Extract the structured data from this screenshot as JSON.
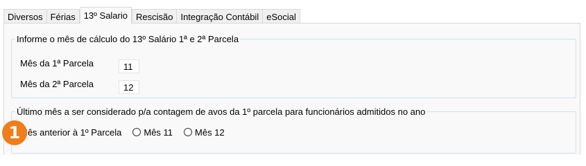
{
  "tabs": [
    {
      "label": "Diversos",
      "active": false
    },
    {
      "label": "Férias",
      "active": false
    },
    {
      "label": "13º Salario",
      "active": true
    },
    {
      "label": "Rescisão",
      "active": false
    },
    {
      "label": "Integração Contábil",
      "active": false
    },
    {
      "label": "eSocial",
      "active": false
    }
  ],
  "group1": {
    "legend": "Informe o mês de cálculo do 13º Salário 1ª e 2ª Parcela",
    "first_installment": {
      "label": "Mês da 1ª Parcela",
      "value": "11"
    },
    "second_installment": {
      "label": "Mês da 2ª Parcela",
      "value": "12"
    }
  },
  "group2": {
    "legend": "Último mês a ser considerado p/a contagem de avos da 1º parcela para funcionários admitidos no ano",
    "options": [
      {
        "label": "Mês anterior à 1º Parcela",
        "checked": false
      },
      {
        "label": "Mês 11",
        "checked": false
      },
      {
        "label": "Mês 12",
        "checked": false
      }
    ]
  },
  "callout_badge": "1",
  "colors": {
    "badge": "#f07d1b",
    "panel": "#f9f9f9",
    "tab_inactive": "#f0f0f0",
    "group_border": "#d5dfe5"
  }
}
